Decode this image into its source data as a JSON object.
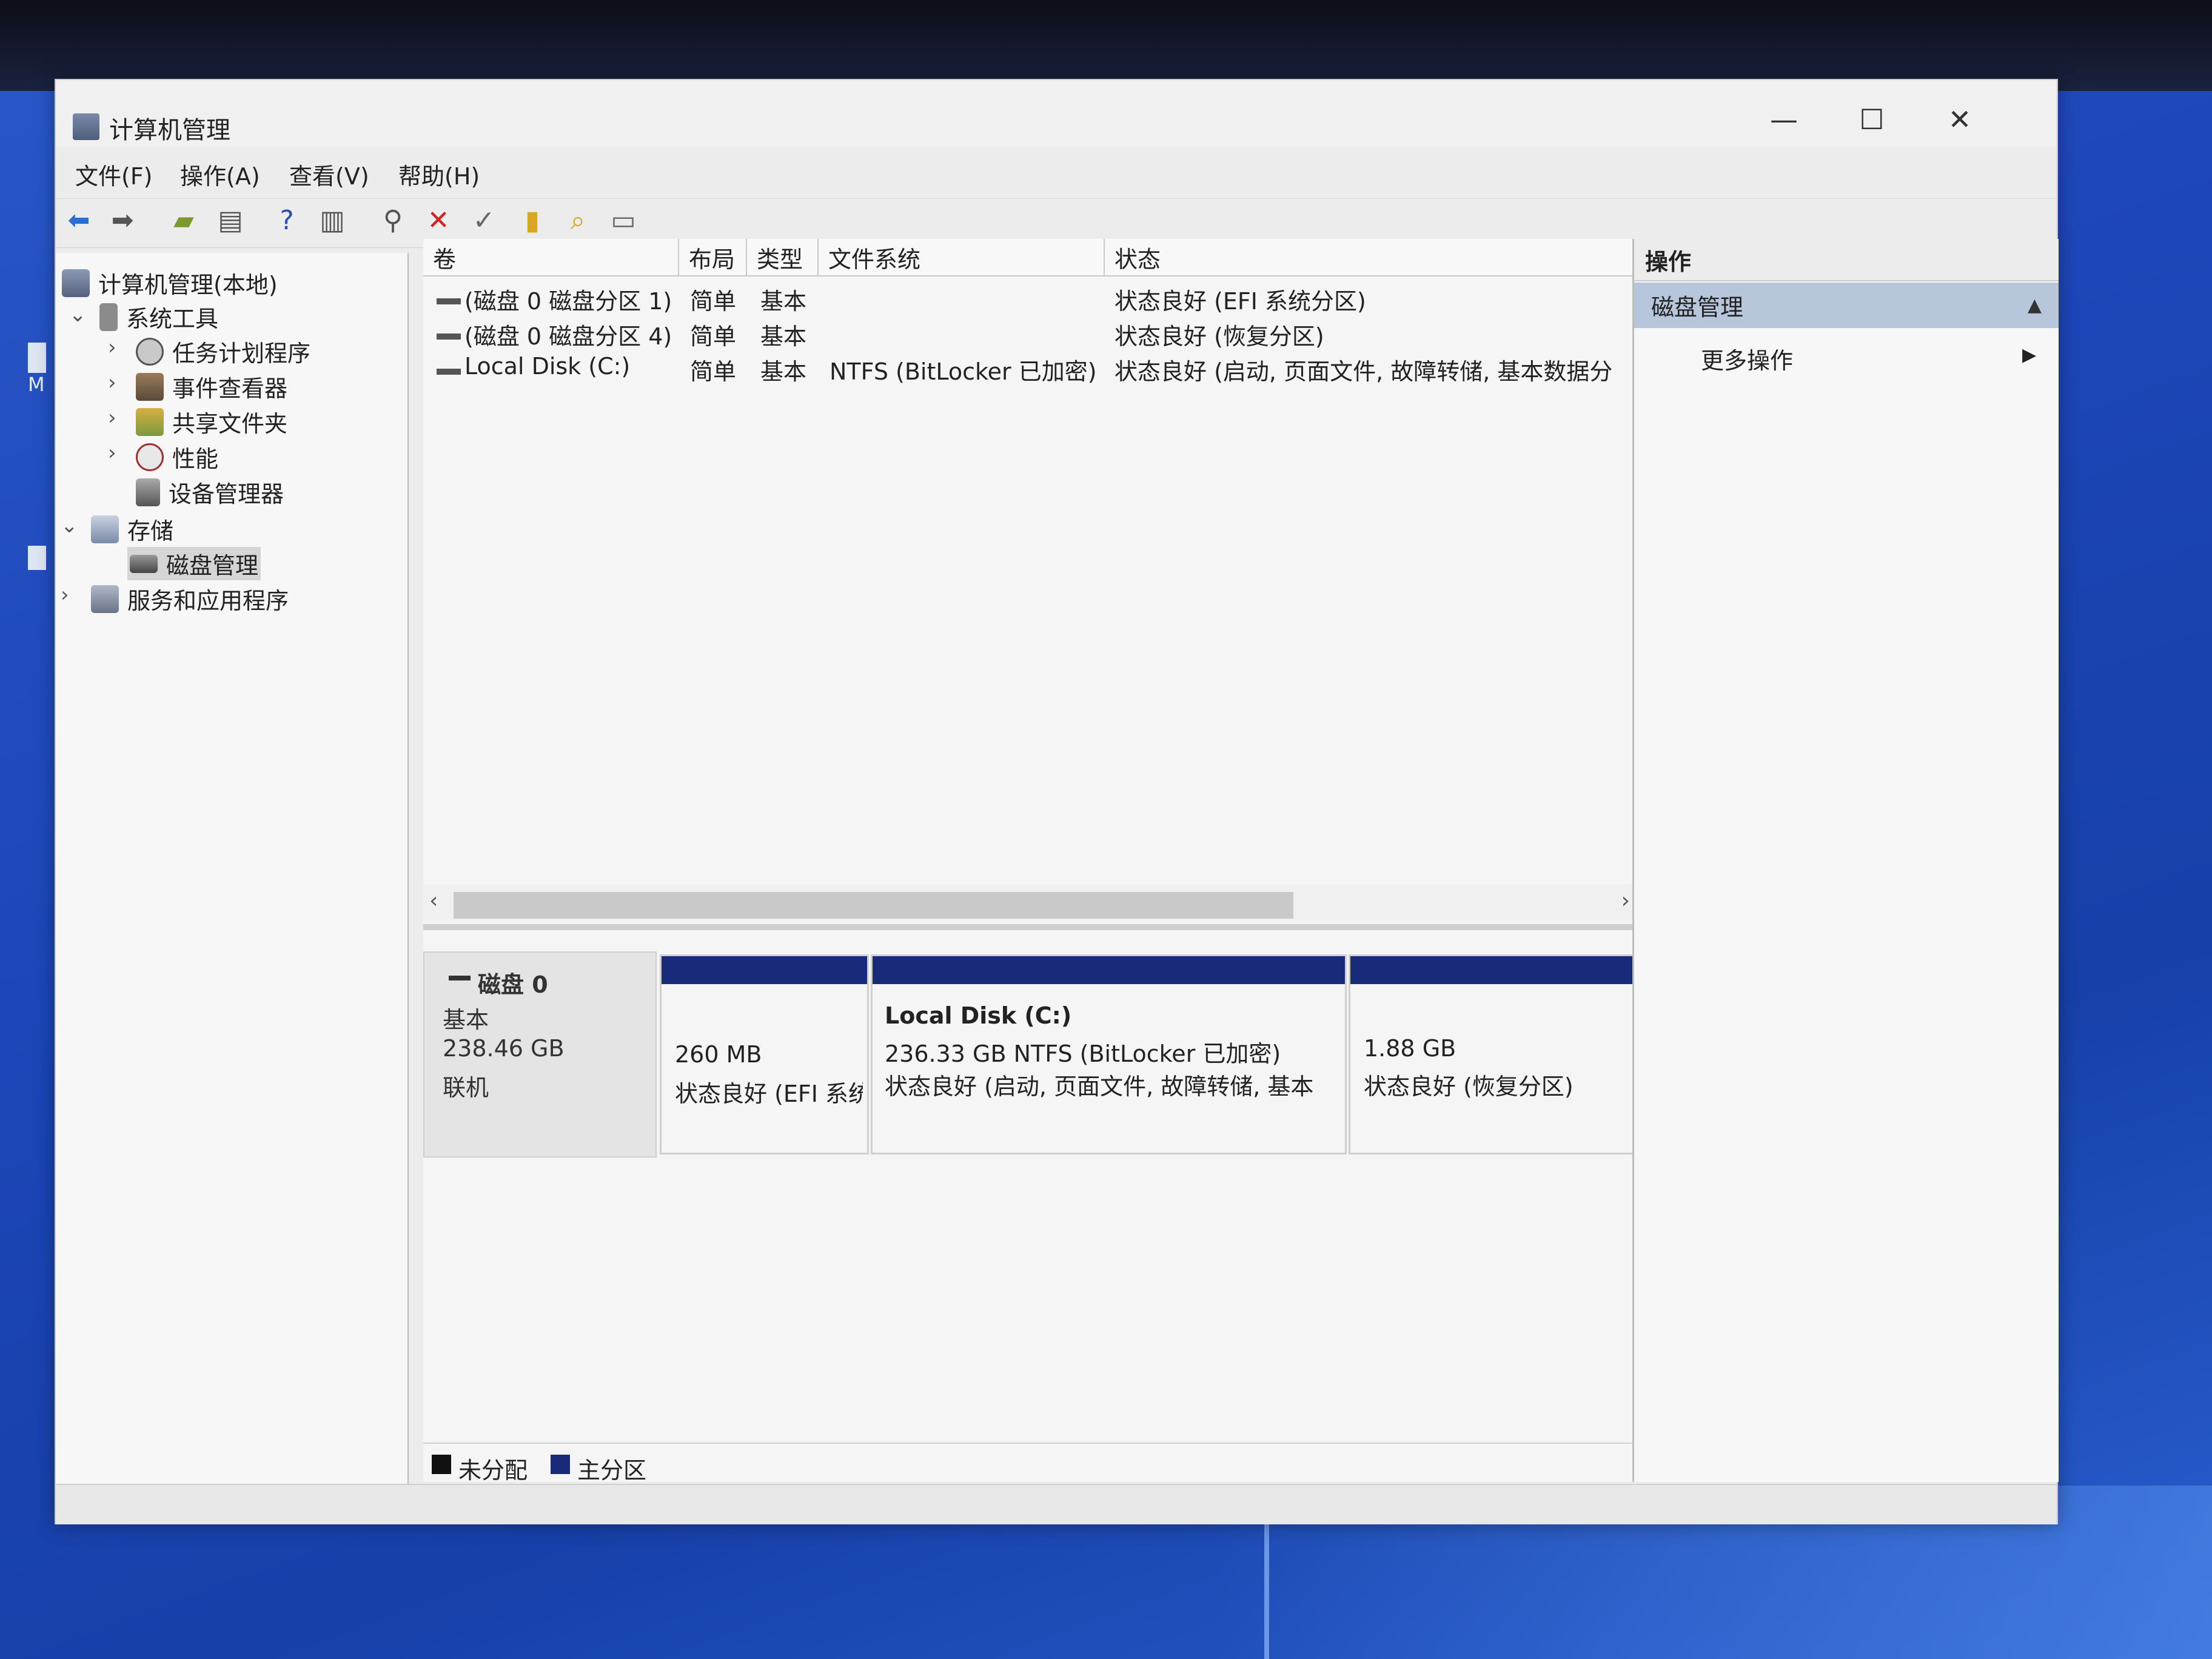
{
  "window": {
    "title": "计算机管理",
    "controls": {
      "minimize": "—",
      "maximize": "☐",
      "close": "✕"
    }
  },
  "menu": [
    "文件(F)",
    "操作(A)",
    "查看(V)",
    "帮助(H)"
  ],
  "toolbar_icons": [
    "back-arrow-icon",
    "forward-arrow-icon",
    "up-folder-icon",
    "show-hide-tree-icon",
    "help-icon",
    "properties-view-icon",
    "connect-icon",
    "delete-icon",
    "check-icon",
    "folder-up-icon",
    "search-folder-icon",
    "details-icon"
  ],
  "tree": {
    "root": "计算机管理(本地)",
    "system_tools": "系统工具",
    "task_scheduler": "任务计划程序",
    "event_viewer": "事件查看器",
    "shared_folders": "共享文件夹",
    "performance": "性能",
    "device_manager": "设备管理器",
    "storage": "存储",
    "disk_management": "磁盘管理",
    "services_apps": "服务和应用程序"
  },
  "volume_list": {
    "headers": {
      "volume": "卷",
      "layout": "布局",
      "type": "类型",
      "filesystem": "文件系统",
      "status": "状态"
    },
    "rows": [
      {
        "volume": "(磁盘 0 磁盘分区 1)",
        "layout": "简单",
        "type": "基本",
        "filesystem": "",
        "status": "状态良好 (EFI 系统分区)"
      },
      {
        "volume": "(磁盘 0 磁盘分区 4)",
        "layout": "简单",
        "type": "基本",
        "filesystem": "",
        "status": "状态良好 (恢复分区)"
      },
      {
        "volume": "Local Disk (C:)",
        "layout": "简单",
        "type": "基本",
        "filesystem": "NTFS (BitLocker 已加密)",
        "status": "状态良好 (启动, 页面文件, 故障转储, 基本数据分"
      }
    ],
    "scroll_left": "‹",
    "scroll_right": "›"
  },
  "disk": {
    "name": "磁盘 0",
    "type": "基本",
    "size": "238.46 GB",
    "state": "联机",
    "partitions": [
      {
        "title": "",
        "size": "260 MB",
        "status": "状态良好 (EFI 系统"
      },
      {
        "title": "Local Disk  (C:)",
        "size": "236.33 GB NTFS (BitLocker 已加密)",
        "status": "状态良好 (启动, 页面文件, 故障转储, 基本"
      },
      {
        "title": "",
        "size": "1.88 GB",
        "status": "状态良好 (恢复分区)"
      }
    ]
  },
  "legend": [
    {
      "label": "未分配",
      "color": "#111111"
    },
    {
      "label": "主分区",
      "color": "#1a2a7a"
    }
  ],
  "actions": {
    "header": "操作",
    "section": "磁盘管理",
    "section_arrow": "▲",
    "more": "更多操作",
    "more_arrow": "▶"
  },
  "desktop": {
    "icon_text": "M"
  }
}
